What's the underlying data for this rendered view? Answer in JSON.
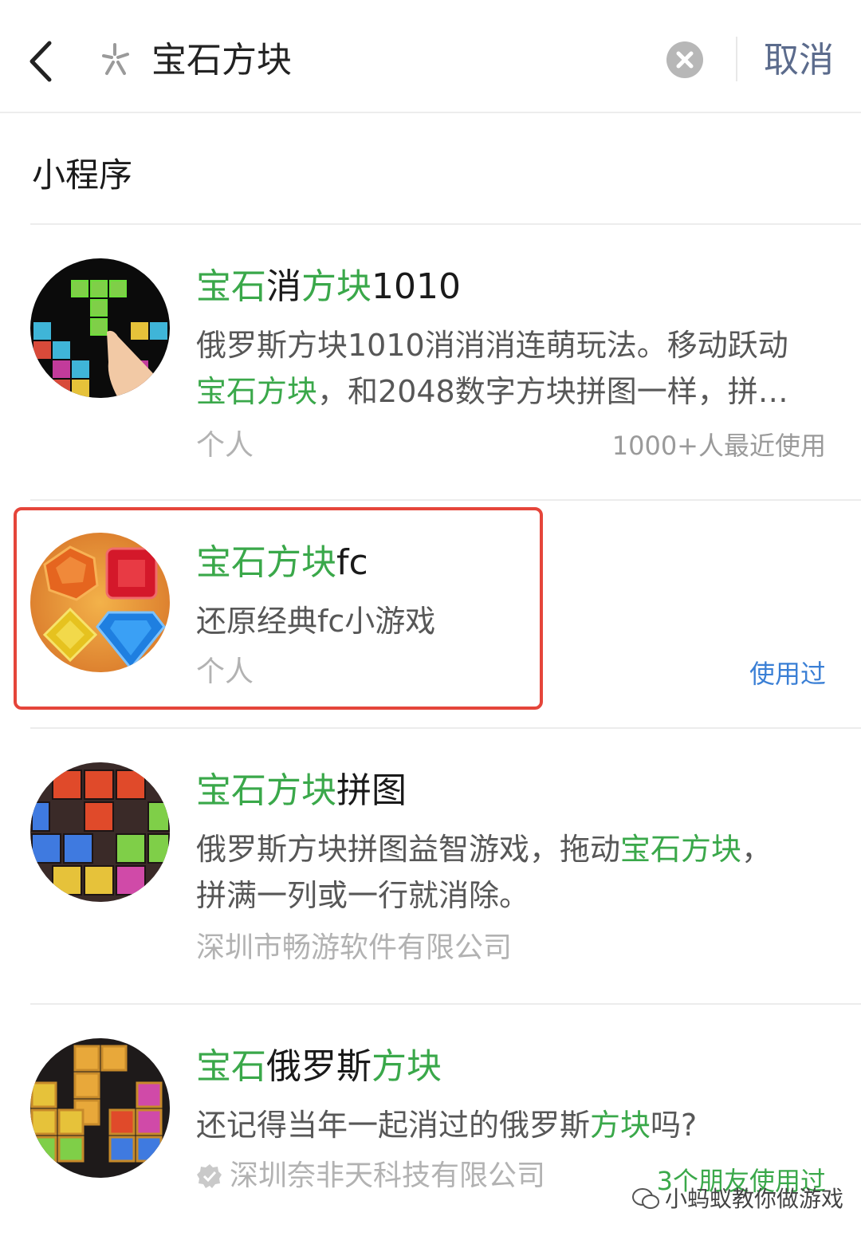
{
  "search": {
    "query": "宝石方块",
    "cancel_label": "取消"
  },
  "section": {
    "title": "小程序"
  },
  "results": [
    {
      "title_parts": [
        "宝石",
        "消",
        "方块",
        "1010"
      ],
      "desc_line1": "俄罗斯方块1010消消消连萌玩法。移动跃动",
      "desc_line2_hl": "宝石方块",
      "desc_line2_rest": "，和2048数字方块拼图一样，拼…",
      "publisher": "个人",
      "usage": "1000+人最近使用"
    },
    {
      "title_hl": "宝石方块",
      "title_rest": "fc",
      "desc": "还原经典fc小游戏",
      "publisher": "个人",
      "usage": "使用过"
    },
    {
      "title_hl": "宝石方块",
      "title_rest": "拼图",
      "desc_a": "俄罗斯方块拼图益智游戏，拖动",
      "desc_hl": "宝石方块",
      "desc_b": "，",
      "desc_line2": "拼满一列或一行就消除。",
      "publisher": "深圳市畅游软件有限公司"
    },
    {
      "title_parts": [
        "宝石",
        "俄罗斯",
        "方块"
      ],
      "desc_a": "还记得当年一起消过的俄罗斯",
      "desc_hl": "方块",
      "desc_b": "吗?",
      "publisher": "深圳奈非天科技有限公司",
      "usage": "3个朋友使用过"
    }
  ],
  "watermark": "小蚂蚁教你做游戏",
  "colors": {
    "highlight_green": "#3aa84a",
    "used_blue": "#3a7fd5",
    "selection_border": "#e5453a"
  },
  "icons": [
    "back-arrow-icon",
    "search-icon",
    "clear-icon",
    "verified-icon",
    "wechat-icon"
  ]
}
